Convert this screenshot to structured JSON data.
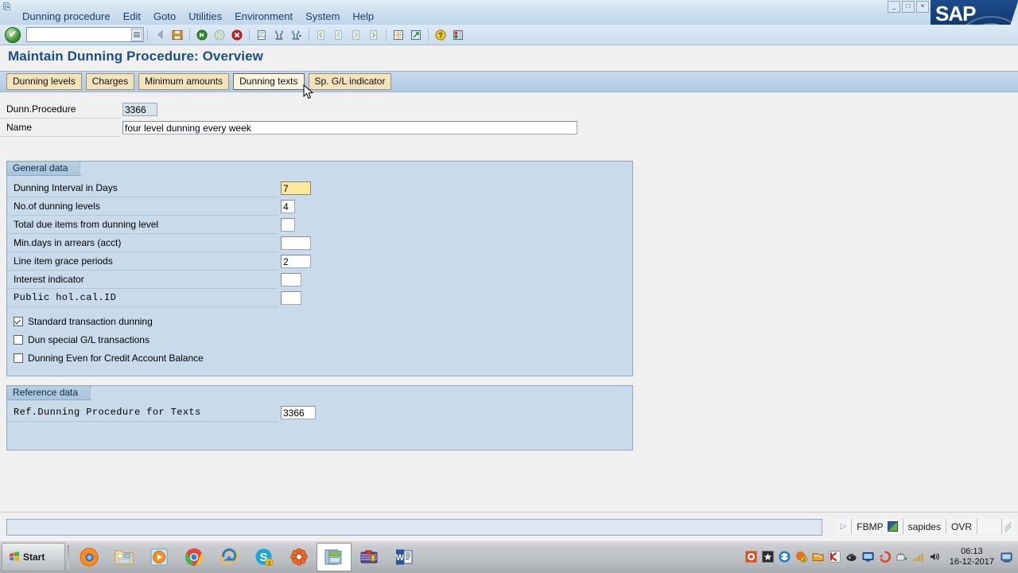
{
  "window": {
    "sys_icon": "system-menu-icon",
    "minimize": "_",
    "restore": "□",
    "close": "×",
    "logo": "SAP"
  },
  "menu": {
    "items": [
      {
        "label": "Dunning procedure"
      },
      {
        "label": "Edit"
      },
      {
        "label": "Goto"
      },
      {
        "label": "Utilities"
      },
      {
        "label": "Environment"
      },
      {
        "label": "System"
      },
      {
        "label": "Help"
      }
    ]
  },
  "toolbar": {
    "ok_label": "✔",
    "command_field_value": "",
    "command_field_placeholder": "",
    "buttons": [
      {
        "name": "back-icon",
        "tip": "Back"
      },
      {
        "name": "save-icon",
        "tip": "Save"
      },
      {
        "name": "exit-icon",
        "tip": "Exit"
      },
      {
        "name": "cancel-icon",
        "tip": "Cancel"
      },
      {
        "name": "stop-icon",
        "tip": "Stop"
      },
      {
        "name": "print-icon",
        "tip": "Print"
      },
      {
        "name": "find-icon",
        "tip": "Find"
      },
      {
        "name": "find-next-icon",
        "tip": "Find Next"
      },
      {
        "name": "first-page-icon",
        "tip": "First Page"
      },
      {
        "name": "previous-page-icon",
        "tip": "Previous Page"
      },
      {
        "name": "next-page-icon",
        "tip": "Next Page"
      },
      {
        "name": "last-page-icon",
        "tip": "Last Page"
      },
      {
        "name": "new-session-icon",
        "tip": "Create New Session"
      },
      {
        "name": "create-shortcut-icon",
        "tip": "Create Shortcut"
      },
      {
        "name": "help-icon",
        "tip": "Help"
      },
      {
        "name": "customize-layout-icon",
        "tip": "Customizing of Local Layout"
      }
    ]
  },
  "page": {
    "title": "Maintain Dunning Procedure: Overview"
  },
  "app_toolbar": {
    "buttons": [
      {
        "label": "Dunning levels",
        "state": "normal"
      },
      {
        "label": "Charges",
        "state": "normal"
      },
      {
        "label": "Minimum amounts",
        "state": "normal"
      },
      {
        "label": "Dunning texts",
        "state": "hover"
      },
      {
        "label": "Sp. G/L indicator",
        "state": "normal"
      }
    ]
  },
  "header": {
    "procedure": {
      "label": "Dunn.Procedure",
      "value": "3366"
    },
    "name": {
      "label": "Name",
      "value": "four level dunning every week"
    }
  },
  "general_data": {
    "title": "General data",
    "fields": [
      {
        "label": "Dunning Interval in Days",
        "value": "7",
        "focused": true,
        "mono": false
      },
      {
        "label": "No.of dunning levels",
        "value": "4",
        "focused": false,
        "mono": false
      },
      {
        "label": "Total due items from dunning level",
        "value": "",
        "focused": false,
        "mono": false
      },
      {
        "label": "Min.days in arrears (acct)",
        "value": "",
        "focused": false,
        "mono": false
      },
      {
        "label": "Line item grace periods",
        "value": "2",
        "focused": false,
        "mono": false
      },
      {
        "label": "Interest indicator",
        "value": "",
        "focused": false,
        "mono": false
      },
      {
        "label": "Public hol.cal.ID",
        "value": "",
        "focused": false,
        "mono": true
      }
    ],
    "checkboxes": [
      {
        "label": "Standard transaction dunning",
        "checked": true
      },
      {
        "label": "Dun special G/L transactions",
        "checked": false
      },
      {
        "label": "Dunning Even for Credit Account Balance",
        "checked": false
      }
    ]
  },
  "reference_data": {
    "title": "Reference data",
    "field": {
      "label": "Ref.Dunning Procedure for Texts",
      "value": "3366"
    }
  },
  "status_bar": {
    "message": "",
    "expand_arrow": "▷",
    "transaction": "FBMP",
    "system_icon": "system-status-icon",
    "server": "sapides",
    "insert_mode": "OVR",
    "spacer": ""
  },
  "taskbar": {
    "start_label": "Start",
    "items": [
      {
        "name": "taskbar-firefox",
        "active": false
      },
      {
        "name": "taskbar-file-explorer",
        "active": false
      },
      {
        "name": "taskbar-media-player",
        "active": false
      },
      {
        "name": "taskbar-chrome",
        "active": false
      },
      {
        "name": "taskbar-internet-explorer",
        "active": false
      },
      {
        "name": "taskbar-skype",
        "active": false
      },
      {
        "name": "taskbar-flower-app",
        "active": false
      },
      {
        "name": "taskbar-sap-logon",
        "active": true
      },
      {
        "name": "taskbar-winrar",
        "active": false
      },
      {
        "name": "taskbar-word",
        "active": false
      }
    ],
    "tray": [
      {
        "name": "tray-flower-icon"
      },
      {
        "name": "tray-dark-icon"
      },
      {
        "name": "tray-teamviewer-icon"
      },
      {
        "name": "tray-update-icon"
      },
      {
        "name": "tray-folder-icon"
      },
      {
        "name": "tray-kaspersky-icon"
      },
      {
        "name": "tray-security-icon"
      },
      {
        "name": "tray-network-monitor-icon"
      },
      {
        "name": "tray-sync-icon"
      },
      {
        "name": "tray-safely-remove-icon"
      },
      {
        "name": "tray-signal-icon"
      },
      {
        "name": "tray-volume-icon"
      }
    ],
    "clock": {
      "time": "06:13",
      "date": "16-12-2017"
    }
  },
  "colors": {
    "accent_blue": "#1b4f8a",
    "panel_blue": "#c9daea",
    "button_tan": "#f2e3bd",
    "focus_yellow": "#fbe9a0",
    "title_orange_rule": "#d9a441"
  }
}
